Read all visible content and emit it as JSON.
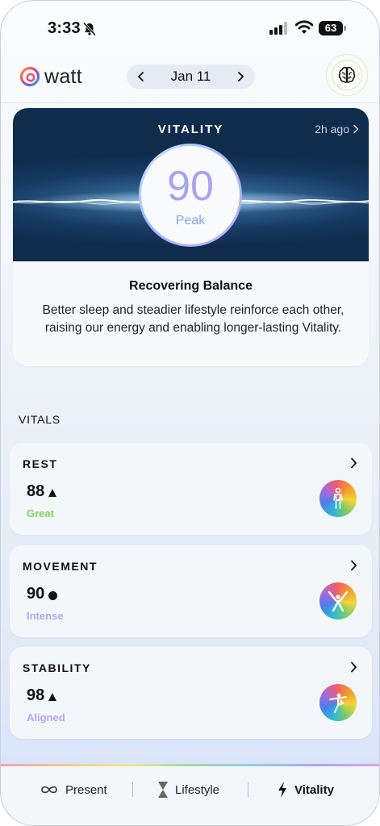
{
  "status_bar": {
    "time": "3:33",
    "battery": "63"
  },
  "header": {
    "app_name": "watt",
    "date": "Jan 11"
  },
  "vitality": {
    "title": "VITALITY",
    "updated": "2h ago",
    "score": "90",
    "level": "Peak",
    "heading": "Recovering Balance",
    "description": "Better sleep and steadier lifestyle reinforce each other, raising our energy and enabling longer-lasting Vitality."
  },
  "vitals": {
    "title": "VITALS",
    "items": [
      {
        "name": "REST",
        "score": "88",
        "trend": "up",
        "status": "Great",
        "status_color": "#7dd25a",
        "icon": "standing-figure-icon"
      },
      {
        "name": "MOVEMENT",
        "score": "90",
        "trend": "steady",
        "status": "Intense",
        "status_color": "#b4a7ec",
        "icon": "jumping-figure-icon"
      },
      {
        "name": "STABILITY",
        "score": "98",
        "trend": "up",
        "status": "Aligned",
        "status_color": "#b4a7ec",
        "icon": "balance-figure-icon"
      }
    ]
  },
  "nav": {
    "items": [
      {
        "label": "Present",
        "icon": "infinity-icon"
      },
      {
        "label": "Lifestyle",
        "icon": "hourglass-icon"
      },
      {
        "label": "Vitality",
        "icon": "lightning-icon",
        "active": true
      }
    ]
  }
}
